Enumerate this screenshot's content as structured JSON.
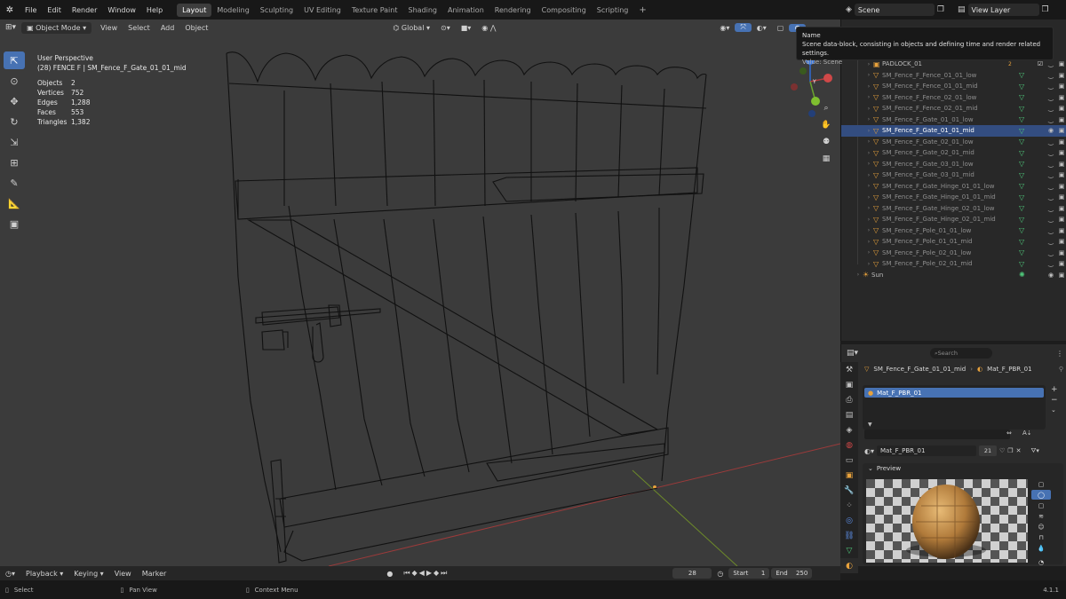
{
  "topbar": {
    "menus": [
      "File",
      "Edit",
      "Render",
      "Window",
      "Help"
    ],
    "workspaces": [
      "Layout",
      "Modeling",
      "Sculpting",
      "UV Editing",
      "Texture Paint",
      "Shading",
      "Animation",
      "Rendering",
      "Compositing",
      "Scripting"
    ],
    "active_workspace": "Layout",
    "add_tab": "+",
    "scene_value": "Scene",
    "view_layer_value": "View Layer"
  },
  "viewport_header": {
    "mode": "Object Mode",
    "menus": [
      "View",
      "Select",
      "Add",
      "Object"
    ],
    "orientation": "Global"
  },
  "viewport": {
    "view_name": "User Perspective",
    "object_info": "(28) FENCE F | SM_Fence_F_Gate_01_01_mid",
    "stats": [
      {
        "k": "Objects",
        "v": "2"
      },
      {
        "k": "Vertices",
        "v": "752"
      },
      {
        "k": "Edges",
        "v": "1,288"
      },
      {
        "k": "Faces",
        "v": "553"
      },
      {
        "k": "Triangles",
        "v": "1,382"
      }
    ],
    "gizmo_axes": {
      "x": "X",
      "y": "Y",
      "z": "Z"
    }
  },
  "tooltip": {
    "title": "Name",
    "description": "Scene data-block, consisting in objects and defining time and render related settings.",
    "value": "Value: Scene"
  },
  "outliner": {
    "items": [
      {
        "label": "PADLOCK_01",
        "badge": "2",
        "selected": false,
        "dim": false
      },
      {
        "label": "SM_Fence_F_Fence_01_01_low",
        "selected": false,
        "dim": true
      },
      {
        "label": "SM_Fence_F_Fence_01_01_mid",
        "selected": false,
        "dim": true
      },
      {
        "label": "SM_Fence_F_Fence_02_01_low",
        "selected": false,
        "dim": true
      },
      {
        "label": "SM_Fence_F_Fence_02_01_mid",
        "selected": false,
        "dim": true
      },
      {
        "label": "SM_Fence_F_Gate_01_01_low",
        "selected": false,
        "dim": true
      },
      {
        "label": "SM_Fence_F_Gate_01_01_mid",
        "selected": true,
        "dim": false
      },
      {
        "label": "SM_Fence_F_Gate_02_01_low",
        "selected": false,
        "dim": true
      },
      {
        "label": "SM_Fence_F_Gate_02_01_mid",
        "selected": false,
        "dim": true
      },
      {
        "label": "SM_Fence_F_Gate_03_01_low",
        "selected": false,
        "dim": true
      },
      {
        "label": "SM_Fence_F_Gate_03_01_mid",
        "selected": false,
        "dim": true
      },
      {
        "label": "SM_Fence_F_Gate_Hinge_01_01_low",
        "selected": false,
        "dim": true
      },
      {
        "label": "SM_Fence_F_Gate_Hinge_01_01_mid",
        "selected": false,
        "dim": true
      },
      {
        "label": "SM_Fence_F_Gate_Hinge_02_01_low",
        "selected": false,
        "dim": true
      },
      {
        "label": "SM_Fence_F_Gate_Hinge_02_01_mid",
        "selected": false,
        "dim": true
      },
      {
        "label": "SM_Fence_F_Pole_01_01_low",
        "selected": false,
        "dim": true
      },
      {
        "label": "SM_Fence_F_Pole_01_01_mid",
        "selected": false,
        "dim": true
      },
      {
        "label": "SM_Fence_F_Pole_02_01_low",
        "selected": false,
        "dim": true
      },
      {
        "label": "SM_Fence_F_Pole_02_01_mid",
        "selected": false,
        "dim": true
      },
      {
        "label": "Sun",
        "selected": false,
        "dim": false
      }
    ]
  },
  "properties": {
    "search_placeholder": "Search",
    "breadcrumb_object": "SM_Fence_F_Gate_01_01_mid",
    "breadcrumb_material": "Mat_F_PBR_01",
    "slot_name": "Mat_F_PBR_01",
    "material_name": "Mat_F_PBR_01",
    "user_count": "21",
    "preview_label": "Preview"
  },
  "timeline": {
    "menus": [
      "Playback",
      "Keying",
      "View",
      "Marker"
    ],
    "current_frame": "28",
    "start_label": "Start",
    "start_value": "1",
    "end_label": "End",
    "end_value": "250"
  },
  "statusbar": {
    "select": "Select",
    "pan": "Pan View",
    "context": "Context Menu",
    "version": "4.1.1"
  },
  "colors": {
    "accent": "#4772b3",
    "viewport_bg": "#3b3b3b",
    "wire": "#0d0d0d",
    "mesh_icon": "#4fc77a",
    "object_icon": "#e8a23c"
  }
}
